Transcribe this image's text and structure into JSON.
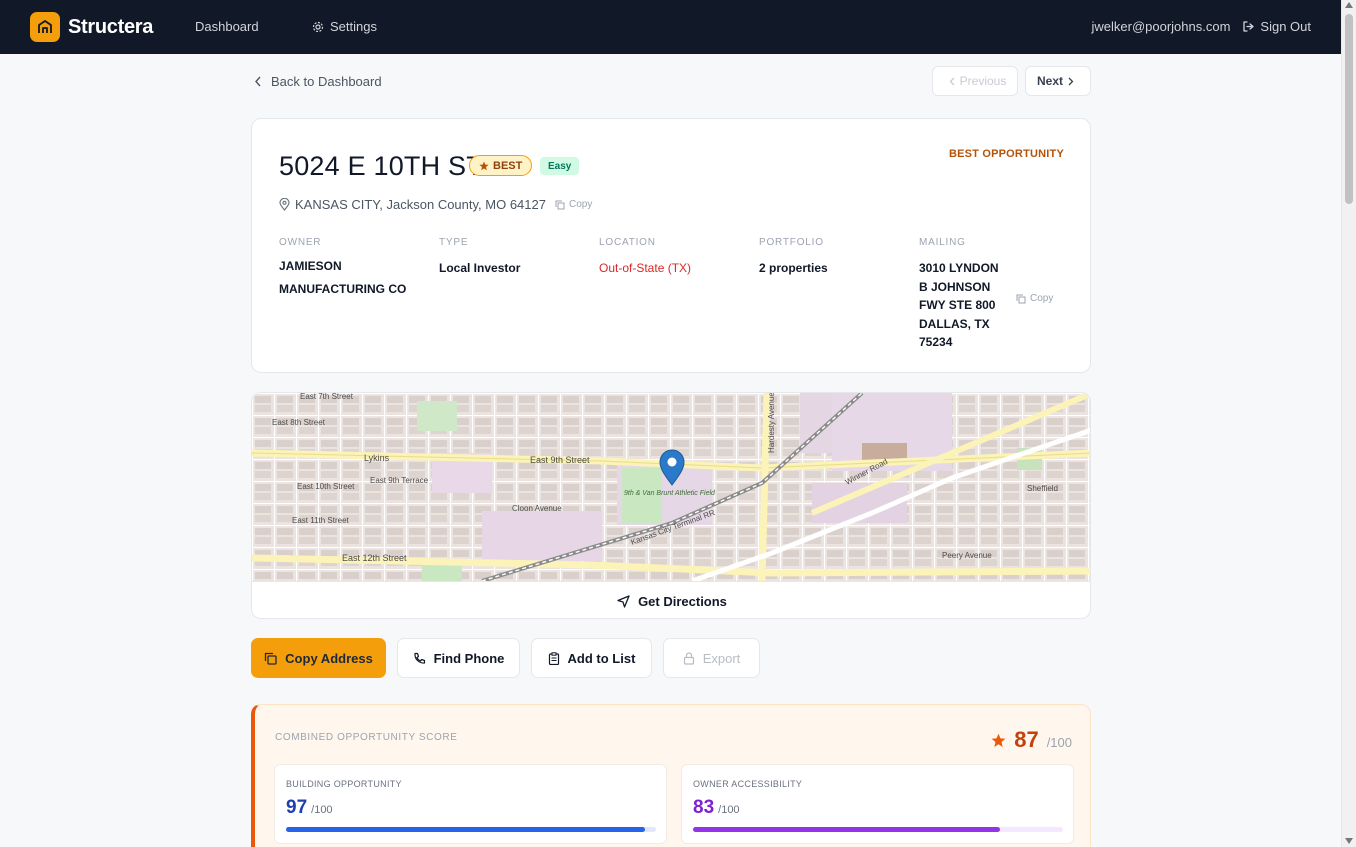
{
  "nav": {
    "brand": "Structera",
    "links": [
      {
        "label": "Dashboard"
      },
      {
        "label": "Settings"
      }
    ],
    "user_email": "jwelker@poorjohns.com",
    "signout_label": "Sign Out"
  },
  "subnav": {
    "back_label": "Back to Dashboard",
    "prev_label": "Previous",
    "next_label": "Next"
  },
  "property": {
    "address": "5024 E 10TH ST",
    "badge_best": "BEST",
    "badge_difficulty": "Easy",
    "opportunity_label": "BEST OPPORTUNITY",
    "location_line": "KANSAS CITY, Jackson County, MO 64127",
    "copy_label": "Copy",
    "fields": [
      {
        "label": "OWNER",
        "value": "JAMIESON MANUFACTURING CO"
      },
      {
        "label": "TYPE",
        "value": "Local Investor"
      },
      {
        "label": "LOCATION",
        "value": "Out-of-State (TX)"
      },
      {
        "label": "PORTFOLIO",
        "value": "2 properties"
      },
      {
        "label": "MAILING",
        "value": "3010 LYNDON B JOHNSON FWY STE 800 DALLAS, TX 75234"
      }
    ]
  },
  "map": {
    "directions_label": "Get Directions",
    "street_labels": [
      "East 7th Street",
      "East 8th Street",
      "East 9th Street",
      "East 10th Street",
      "East 11th Street",
      "East 12th Street",
      "Lykins",
      "Cloon Avenue",
      "Winner Road",
      "Sheffield",
      "9th & Van Brunt Athletic Field",
      "Kansas City Terminal RR",
      "Hardesty Avenue",
      "Peery Avenue",
      "East 9th Terrace"
    ]
  },
  "actions": {
    "copy_address": "Copy Address",
    "find_phone": "Find Phone",
    "add_to_list": "Add to List",
    "export": "Export"
  },
  "scores": {
    "combined_label": "COMBINED OPPORTUNITY SCORE",
    "combined_value": "87",
    "denominator": "/100",
    "building": {
      "label": "BUILDING OPPORTUNITY",
      "value": "97",
      "denominator": "/100",
      "percent": 97,
      "color": "#2563eb",
      "track": "#e0e7ff"
    },
    "owner": {
      "label": "OWNER ACCESSIBILITY",
      "value": "83",
      "denominator": "/100",
      "percent": 83,
      "color": "#9333ea",
      "track": "#f3e8ff"
    }
  },
  "colors": {
    "accent": "#f59e0b",
    "nav_bg": "#111827",
    "danger": "#dc2626",
    "score_accent": "#c2410c"
  }
}
